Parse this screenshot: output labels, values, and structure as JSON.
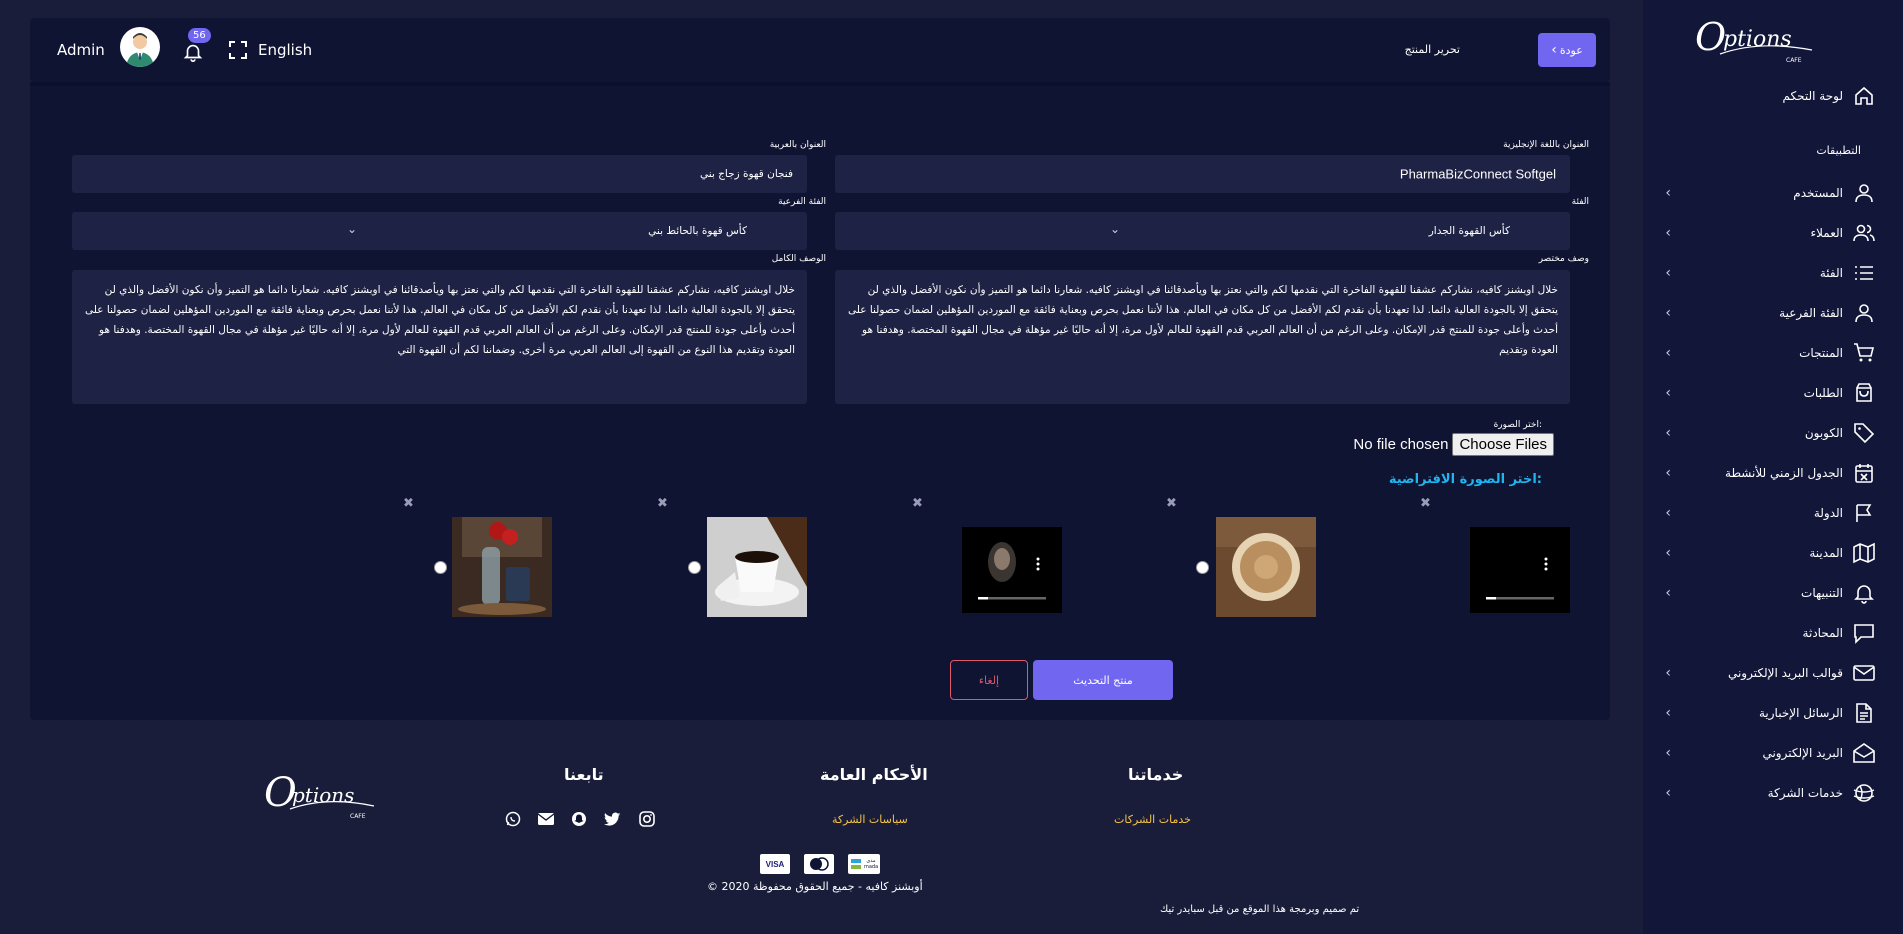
{
  "sidebar": {
    "header": "التطبيقات",
    "items": [
      {
        "label": "لوحة التحكم",
        "icon": "home-icon",
        "chevron": false
      },
      {
        "label": "المستخدم",
        "icon": "user-icon",
        "chevron": true
      },
      {
        "label": "العملاء",
        "icon": "users-icon",
        "chevron": true
      },
      {
        "label": "الفئة",
        "icon": "list-icon",
        "chevron": true
      },
      {
        "label": "الفئة الفرعية",
        "icon": "user-icon",
        "chevron": true
      },
      {
        "label": "المنتجات",
        "icon": "cart-icon",
        "chevron": true
      },
      {
        "label": "الطلبات",
        "icon": "bag-icon",
        "chevron": true
      },
      {
        "label": "الكوبون",
        "icon": "tag-icon",
        "chevron": true
      },
      {
        "label": "الجدول الزمني للأنشطة",
        "icon": "calendar-x-icon",
        "chevron": true
      },
      {
        "label": "الدولة",
        "icon": "flag-icon",
        "chevron": true
      },
      {
        "label": "المدينة",
        "icon": "map-icon",
        "chevron": true
      },
      {
        "label": "التنبيهات",
        "icon": "bell-icon",
        "chevron": true
      },
      {
        "label": "المحادثة",
        "icon": "chat-icon",
        "chevron": false
      },
      {
        "label": "قوالب البريد الإلكتروني",
        "icon": "mail-icon",
        "chevron": true
      },
      {
        "label": "الرسائل الإخبارية",
        "icon": "file-icon",
        "chevron": true
      },
      {
        "label": "البريد الإلكتروني",
        "icon": "mail-open-icon",
        "chevron": true
      },
      {
        "label": "خدمات الشركة",
        "icon": "globe-icon",
        "chevron": true
      }
    ]
  },
  "topbar": {
    "user_name": "Admin",
    "notification_count": "56",
    "language": "English",
    "page_title": "تحرير المنتج",
    "back_label": "عودة"
  },
  "form": {
    "title_en_label": "العنوان باللغة الإنجليزية",
    "title_en_value": "PharmaBizConnect Softgel",
    "title_ar_label": "العنوان بالعربية",
    "title_ar_value": "فنجان قهوة زجاج بني",
    "category_label": "الفئة",
    "category_value": "كأس القهوة الجدار",
    "subcategory_label": "الفئة الفرعية",
    "subcategory_value": "كأس قهوة بالحائط بني",
    "short_desc_label": "وصف مختصر",
    "short_desc_value": "خلال اوبشنز كافيه، نشاركم عشقنا للقهوة الفاخرة التي نقدمها لكم والتي نعتز بها ويأصدقائنا في اوبشنز كافيه. شعارنا دائما هو التميز وأن نكون الأفضل والذي لن يتحقق إلا بالجودة العالية دائما. لذا تعهدنا بأن نقدم لكم الأفضل من كل مكان في العالم. هذا لأننا نعمل بحرص وبعناية فائقة مع الموردين المؤهلين لضمان حصولنا على أحدث وأعلى جودة للمنتج قدر الإمكان. وعلى الرغم من أن العالم العربي قدم القهوة للعالم لأول مرة، إلا أنه حاليًا غير مؤهلة في مجال القهوة المختصة. وهدفنا هو العودة وتقديم",
    "full_desc_label": "الوصف الكامل",
    "full_desc_value": "خلال اوبشنز كافيه، نشاركم عشقنا للقهوة الفاخرة التي نقدمها لكم والتي نعتز بها ويأصدقائنا في اوبشنز كافيه. شعارنا دائما هو التميز وأن نكون الأفضل والذي لن يتحقق إلا بالجودة العالية دائما. لذا تعهدنا بأن نقدم لكم الأفضل من كل مكان في العالم. هذا لأننا نعمل بحرص وبعناية فائقة مع الموردين المؤهلين لضمان حصولنا على أحدث وأعلى جودة للمنتج قدر الإمكان. وعلى الرغم من أن العالم العربي قدم القهوة للعالم لأول مرة، إلا أنه حاليًا غير مؤهلة في مجال القهوة المختصة. وهدفنا هو العودة وتقديم هذا النوع من القهوة إلى العالم العربي مرة أخرى. وضماننا لكم أن القهوة التي",
    "image_label": "اختر الصورة:",
    "file_status": "No file chosen",
    "choose_files": "Choose Files",
    "default_image_label": "اختر الصورة الافتراضية:",
    "selected_image_index": 1,
    "update_button": "منتج التحديث",
    "cancel_button": "إلغاء"
  },
  "footer": {
    "services_title": "خدماتنا",
    "services_link": "خدمات الشركات",
    "terms_title": "الأحكام العامة",
    "terms_link": "سياسات الشركة",
    "follow_title": "تابعنا",
    "copyright": "© 2020 أوبشنز كافيه - جميع الحقوق محفوظة",
    "credit": "تم صميم وبرمجة هذا الموقع من قبل سبايدر تيك",
    "mada_text": "مدى mada",
    "visa_text": "VISA",
    "logo_text": "Options",
    "logo_sub": "CAFE"
  },
  "colors": {
    "accent": "#7166f0",
    "cancel": "#e0566b",
    "link": "#f6c443",
    "heading_cyan": "#1fb6f0"
  }
}
